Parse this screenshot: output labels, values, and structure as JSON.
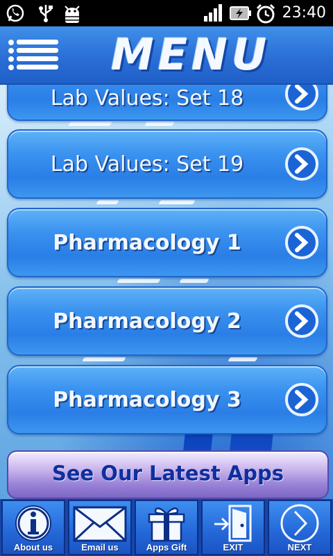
{
  "status_bar": {
    "time": "23:40",
    "icons": [
      "whatsapp-icon",
      "usb-icon",
      "android-debug-icon",
      "signal-icon",
      "battery-charging-icon",
      "alarm-icon"
    ]
  },
  "header": {
    "title": "MENU",
    "menu_icon": "hamburger-list-icon",
    "bg_color": "#2a6fd6"
  },
  "menu_items": [
    {
      "label": "Lab Values: Set 18",
      "icon": "chevron-right-circle-icon"
    },
    {
      "label": "Lab Values: Set 19",
      "icon": "chevron-right-circle-icon"
    },
    {
      "label": "Pharmacology 1",
      "icon": "chevron-right-circle-icon"
    },
    {
      "label": "Pharmacology 2",
      "icon": "chevron-right-circle-icon"
    },
    {
      "label": "Pharmacology 3",
      "icon": "chevron-right-circle-icon"
    }
  ],
  "promo": {
    "label": "See Our Latest Apps"
  },
  "bottom_bar": [
    {
      "label": "About us",
      "icon": "info-icon"
    },
    {
      "label": "Email us",
      "icon": "envelope-icon"
    },
    {
      "label": "Apps Gift",
      "icon": "gift-icon"
    },
    {
      "label": "EXIT",
      "icon": "exit-door-icon"
    },
    {
      "label": "NEXT",
      "icon": "chevron-right-circle-icon"
    }
  ],
  "colors": {
    "accent": "#2a7ee6",
    "bottom_bar": "#1746a8",
    "promo_text": "#0f2f9c"
  }
}
